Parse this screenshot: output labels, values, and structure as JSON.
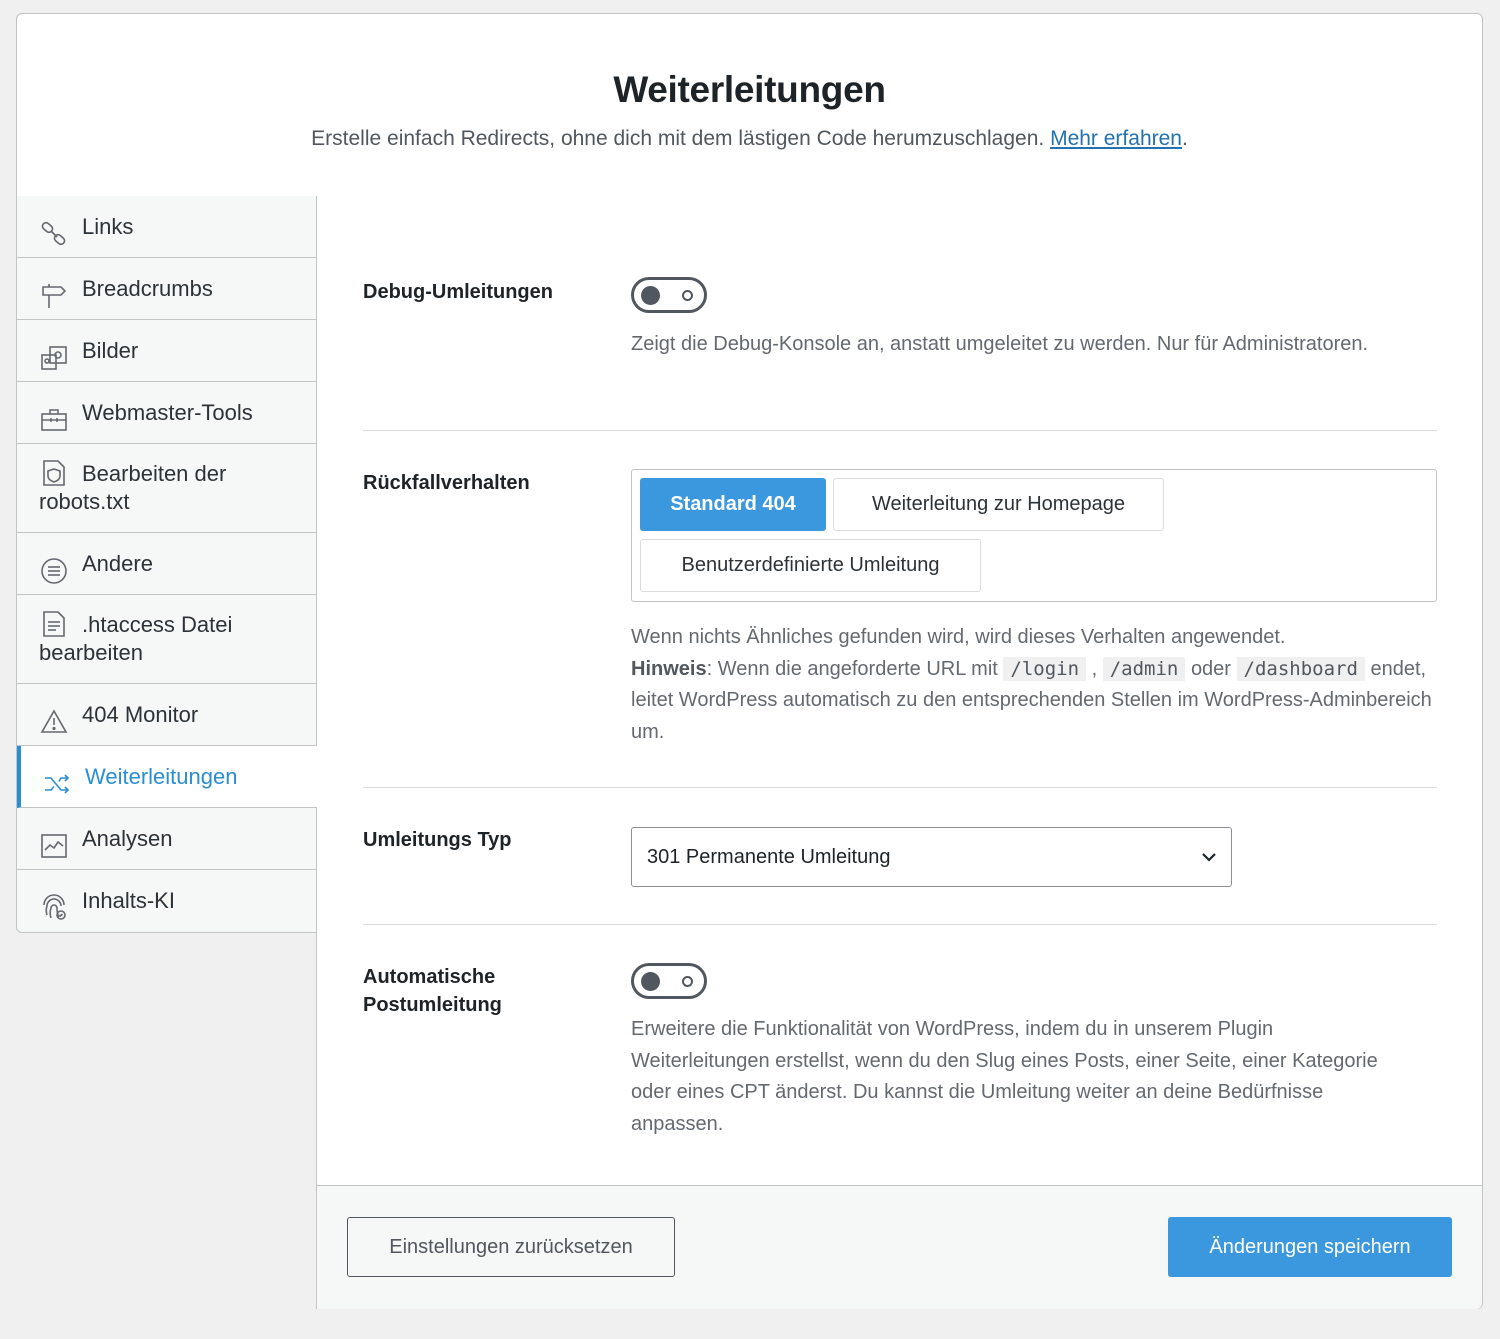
{
  "header": {
    "title": "Weiterleitungen",
    "subtitle": "Erstelle einfach Redirects, ohne dich mit dem lästigen Code herumzuschlagen.",
    "learn_more": "Mehr erfahren",
    "period": "."
  },
  "sidebar": {
    "items": [
      {
        "label": "Links",
        "icon": "link-icon"
      },
      {
        "label": "Breadcrumbs",
        "icon": "signpost-icon"
      },
      {
        "label": "Bilder",
        "icon": "images-icon"
      },
      {
        "label": "Webmaster-Tools",
        "icon": "toolbox-icon"
      },
      {
        "label": "Bearbeiten der robots.txt",
        "icon": "robots-file-icon"
      },
      {
        "label": "Andere",
        "icon": "list-circle-icon"
      },
      {
        "label": ".htaccess Datei bearbeiten",
        "icon": "file-text-icon"
      },
      {
        "label": "404 Monitor",
        "icon": "warning-icon"
      },
      {
        "label": "Weiterleitungen",
        "icon": "shuffle-icon",
        "active": true
      },
      {
        "label": "Analysen",
        "icon": "chart-icon"
      },
      {
        "label": "Inhalts-KI",
        "icon": "fingerprint-icon"
      }
    ]
  },
  "settings": {
    "debug": {
      "label": "Debug-Umleitungen",
      "enabled": false,
      "description": "Zeigt die Debug-Konsole an, anstatt umgeleitet zu werden. Nur für Administratoren."
    },
    "fallback": {
      "label": "Rückfallverhalten",
      "options": [
        "Standard 404",
        "Weiterleitung zur Homepage",
        "Benutzerdefinierte Umleitung"
      ],
      "selected": "Standard 404",
      "description_1": "Wenn nichts Ähnliches gefunden wird, wird dieses Verhalten angewendet.",
      "hint_label": "Hinweis",
      "hint_1": ": Wenn die angeforderte URL mit",
      "code_1": "/login",
      "sep": ",",
      "code_2": "/admin",
      "or": "oder",
      "code_3": "/dashboard",
      "hint_2": "endet, leitet WordPress automatisch zu den entsprechenden Stellen im WordPress-Adminbereich um."
    },
    "redirect_type": {
      "label": "Umleitungs Typ",
      "value": "301 Permanente Umleitung"
    },
    "auto_post": {
      "label": "Automatische Postumleitung",
      "enabled": false,
      "description": "Erweitere die Funktionalität von WordPress, indem du in unserem Plugin Weiterleitungen erstellst, wenn du den Slug eines Posts, einer Seite, einer Kategorie oder eines CPT änderst. Du kannst die Umleitung weiter an deine Bedürfnisse anpassen."
    }
  },
  "footer": {
    "reset": "Einstellungen zurücksetzen",
    "save": "Änderungen speichern"
  },
  "colors": {
    "accent": "#3b97de",
    "active_nav": "#2a8ed2",
    "link": "#2271b1"
  }
}
